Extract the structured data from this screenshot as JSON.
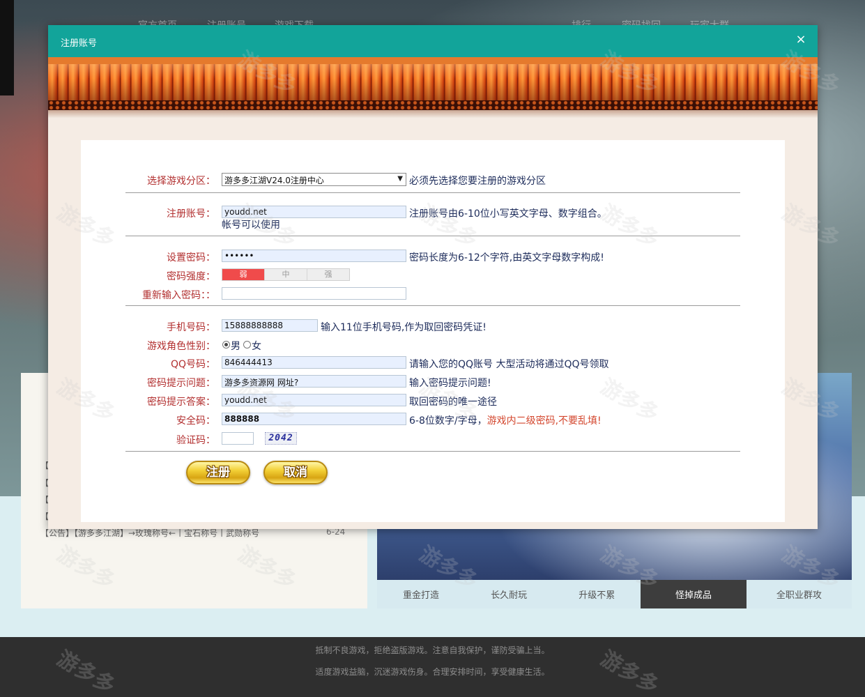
{
  "background": {
    "nav": [
      "官方首页",
      "注册账号",
      "游戏下载",
      "排行",
      "密码找回",
      "玩家大群"
    ],
    "news": {
      "items": [
        "【公",
        "【公",
        "【公",
        "【公"
      ],
      "last_item": "【公告】【游多多江湖】→玫瑰称号←丨宝石称号丨武勋称号",
      "last_date": "6-24"
    },
    "feature_tabs": [
      "重金打造",
      "长久耐玩",
      "升级不累",
      "怪掉成品",
      "全职业群攻"
    ],
    "active_tab_index": 3,
    "footer": {
      "line1": "抵制不良游戏，拒绝盗版游戏。注意自我保护，谨防受骗上当。",
      "line2": "适度游戏益脑，沉迷游戏伤身。合理安排时间，享受健康生活。"
    },
    "watermark": "游多多"
  },
  "modal": {
    "title": "注册账号",
    "close_glyph": "×"
  },
  "form": {
    "server": {
      "label": "选择游戏分区：",
      "value": "游多多江湖V24.0注册中心",
      "hint": "必须先选择您要注册的游戏分区"
    },
    "account": {
      "label": "注册账号：",
      "value": "youdd.net",
      "hint": "注册账号由6-10位小写英文字母、数字组合。",
      "status": "帐号可以使用"
    },
    "password": {
      "label": "设置密码：",
      "value": "••••••",
      "hint": "密码长度为6-12个字符,由英文字母数字构成!"
    },
    "strength": {
      "label": "密码强度：",
      "levels": [
        "弱",
        "中",
        "强"
      ],
      "current": "弱"
    },
    "confirm": {
      "label": "重新输入密码：：",
      "value": ""
    },
    "phone": {
      "label": "手机号码：",
      "value": "15888888888",
      "hint": "输入11位手机号码,作为取回密码凭证!"
    },
    "gender": {
      "label": "游戏角色性别：",
      "options": [
        "男",
        "女"
      ],
      "selected": "男"
    },
    "qq": {
      "label": "QQ号码：",
      "value": "846444413",
      "hint": "请输入您的QQ账号 大型活动将通过QQ号领取"
    },
    "question": {
      "label": "密码提示问题：",
      "value": "游多多资源网 网址?",
      "hint": "输入密码提示问题!"
    },
    "answer": {
      "label": "密码提示答案：",
      "value": "youdd.net",
      "hint": "取回密码的唯一途径"
    },
    "security": {
      "label": "安全码：",
      "value": "888888",
      "hint": "6-8位数字/字母，",
      "warning": "游戏内二级密码,不要乱填!"
    },
    "captcha": {
      "label": "验证码：",
      "value": "",
      "image_text": "2042"
    },
    "buttons": {
      "register": "注册",
      "cancel": "取消"
    }
  },
  "colors": {
    "header": "#12a49a",
    "label": "#b22f2f",
    "hint": "#1c2b5a",
    "warning": "#d3462d",
    "weak": "#f04b4b"
  }
}
